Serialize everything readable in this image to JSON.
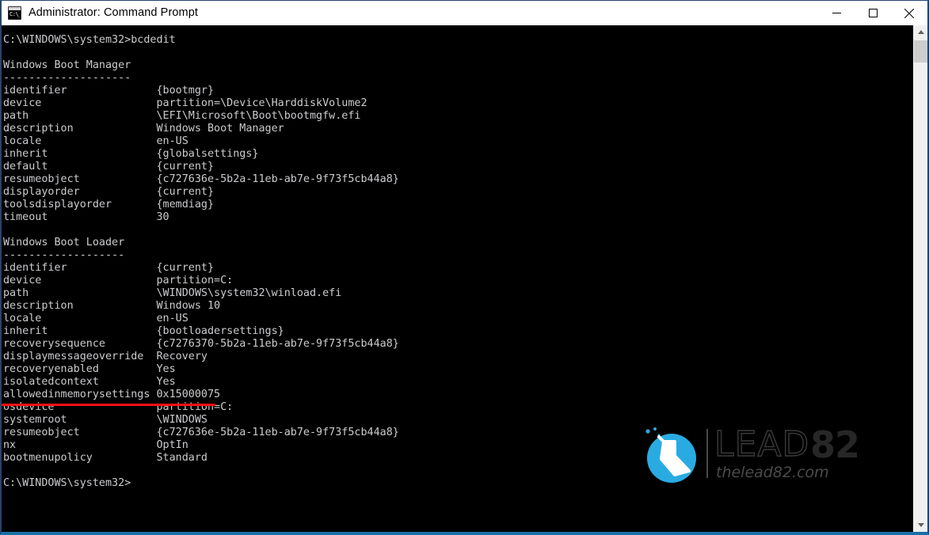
{
  "window": {
    "title": "Administrator: Command Prompt",
    "icon": "command-prompt-icon",
    "icon_glyph": "C:\\_",
    "minimize_label": "Minimize",
    "maximize_label": "Maximize",
    "close_label": "Close",
    "border_color": "#24456e",
    "accent_bottom_color": "#1a6fa8"
  },
  "terminal": {
    "background": "#000000",
    "foreground": "#ccccd0",
    "prompt_command": "C:\\WINDOWS\\system32>bcdedit",
    "trailing_prompt": "C:\\WINDOWS\\system32>",
    "lines": [
      "C:\\WINDOWS\\system32>bcdedit",
      "",
      "Windows Boot Manager",
      "--------------------",
      "identifier              {bootmgr}",
      "device                  partition=\\Device\\HarddiskVolume2",
      "path                    \\EFI\\Microsoft\\Boot\\bootmgfw.efi",
      "description             Windows Boot Manager",
      "locale                  en-US",
      "inherit                 {globalsettings}",
      "default                 {current}",
      "resumeobject            {c727636e-5b2a-11eb-ab7e-9f73f5cb44a8}",
      "displayorder            {current}",
      "toolsdisplayorder       {memdiag}",
      "timeout                 30",
      "",
      "Windows Boot Loader",
      "-------------------",
      "identifier              {current}",
      "device                  partition=C:",
      "path                    \\WINDOWS\\system32\\winload.efi",
      "description             Windows 10",
      "locale                  en-US",
      "inherit                 {bootloadersettings}",
      "recoverysequence        {c7276370-5b2a-11eb-ab7e-9f73f5cb44a8}",
      "displaymessageoverride  Recovery",
      "recoveryenabled         Yes",
      "isolatedcontext         Yes",
      "allowedinmemorysettings 0x15000075",
      "osdevice                partition=C:",
      "systemroot              \\WINDOWS",
      "resumeobject            {c727636e-5b2a-11eb-ab7e-9f73f5cb44a8}",
      "nx                      OptIn",
      "bootmenupolicy          Standard",
      "",
      "C:\\WINDOWS\\system32>"
    ],
    "sections": [
      {
        "heading": "Windows Boot Manager",
        "rule": "--------------------",
        "entries": [
          {
            "key": "identifier",
            "value": "{bootmgr}"
          },
          {
            "key": "device",
            "value": "partition=\\Device\\HarddiskVolume2"
          },
          {
            "key": "path",
            "value": "\\EFI\\Microsoft\\Boot\\bootmgfw.efi"
          },
          {
            "key": "description",
            "value": "Windows Boot Manager"
          },
          {
            "key": "locale",
            "value": "en-US"
          },
          {
            "key": "inherit",
            "value": "{globalsettings}"
          },
          {
            "key": "default",
            "value": "{current}"
          },
          {
            "key": "resumeobject",
            "value": "{c727636e-5b2a-11eb-ab7e-9f73f5cb44a8}"
          },
          {
            "key": "displayorder",
            "value": "{current}"
          },
          {
            "key": "toolsdisplayorder",
            "value": "{memdiag}"
          },
          {
            "key": "timeout",
            "value": "30"
          }
        ]
      },
      {
        "heading": "Windows Boot Loader",
        "rule": "-------------------",
        "entries": [
          {
            "key": "identifier",
            "value": "{current}"
          },
          {
            "key": "device",
            "value": "partition=C:"
          },
          {
            "key": "path",
            "value": "\\WINDOWS\\system32\\winload.efi"
          },
          {
            "key": "description",
            "value": "Windows 10"
          },
          {
            "key": "locale",
            "value": "en-US"
          },
          {
            "key": "inherit",
            "value": "{bootloadersettings}"
          },
          {
            "key": "recoverysequence",
            "value": "{c7276370-5b2a-11eb-ab7e-9f73f5cb44a8}"
          },
          {
            "key": "displaymessageoverride",
            "value": "Recovery"
          },
          {
            "key": "recoveryenabled",
            "value": "Yes"
          },
          {
            "key": "isolatedcontext",
            "value": "Yes"
          },
          {
            "key": "allowedinmemorysettings",
            "value": "0x15000075"
          },
          {
            "key": "osdevice",
            "value": "partition=C:"
          },
          {
            "key": "systemroot",
            "value": "\\WINDOWS"
          },
          {
            "key": "resumeobject",
            "value": "{c727636e-5b2a-11eb-ab7e-9f73f5cb44a8}"
          },
          {
            "key": "nx",
            "value": "OptIn"
          },
          {
            "key": "bootmenupolicy",
            "value": "Standard"
          }
        ]
      }
    ]
  },
  "annotation": {
    "type": "underline",
    "target_line": "recoveryenabled",
    "color": "#ff0f12"
  },
  "watermark": {
    "brand_outline": "LEAD",
    "brand_solid": "82",
    "url": "thelead82.com",
    "circle_color": "#29abe2",
    "icon": "flask-icon"
  },
  "scrollbar": {
    "up_arrow": "scroll-up-arrow",
    "down_arrow": "scroll-down-arrow",
    "track_color": "#f0f0f0",
    "thumb_color": "#cdcdcd"
  }
}
